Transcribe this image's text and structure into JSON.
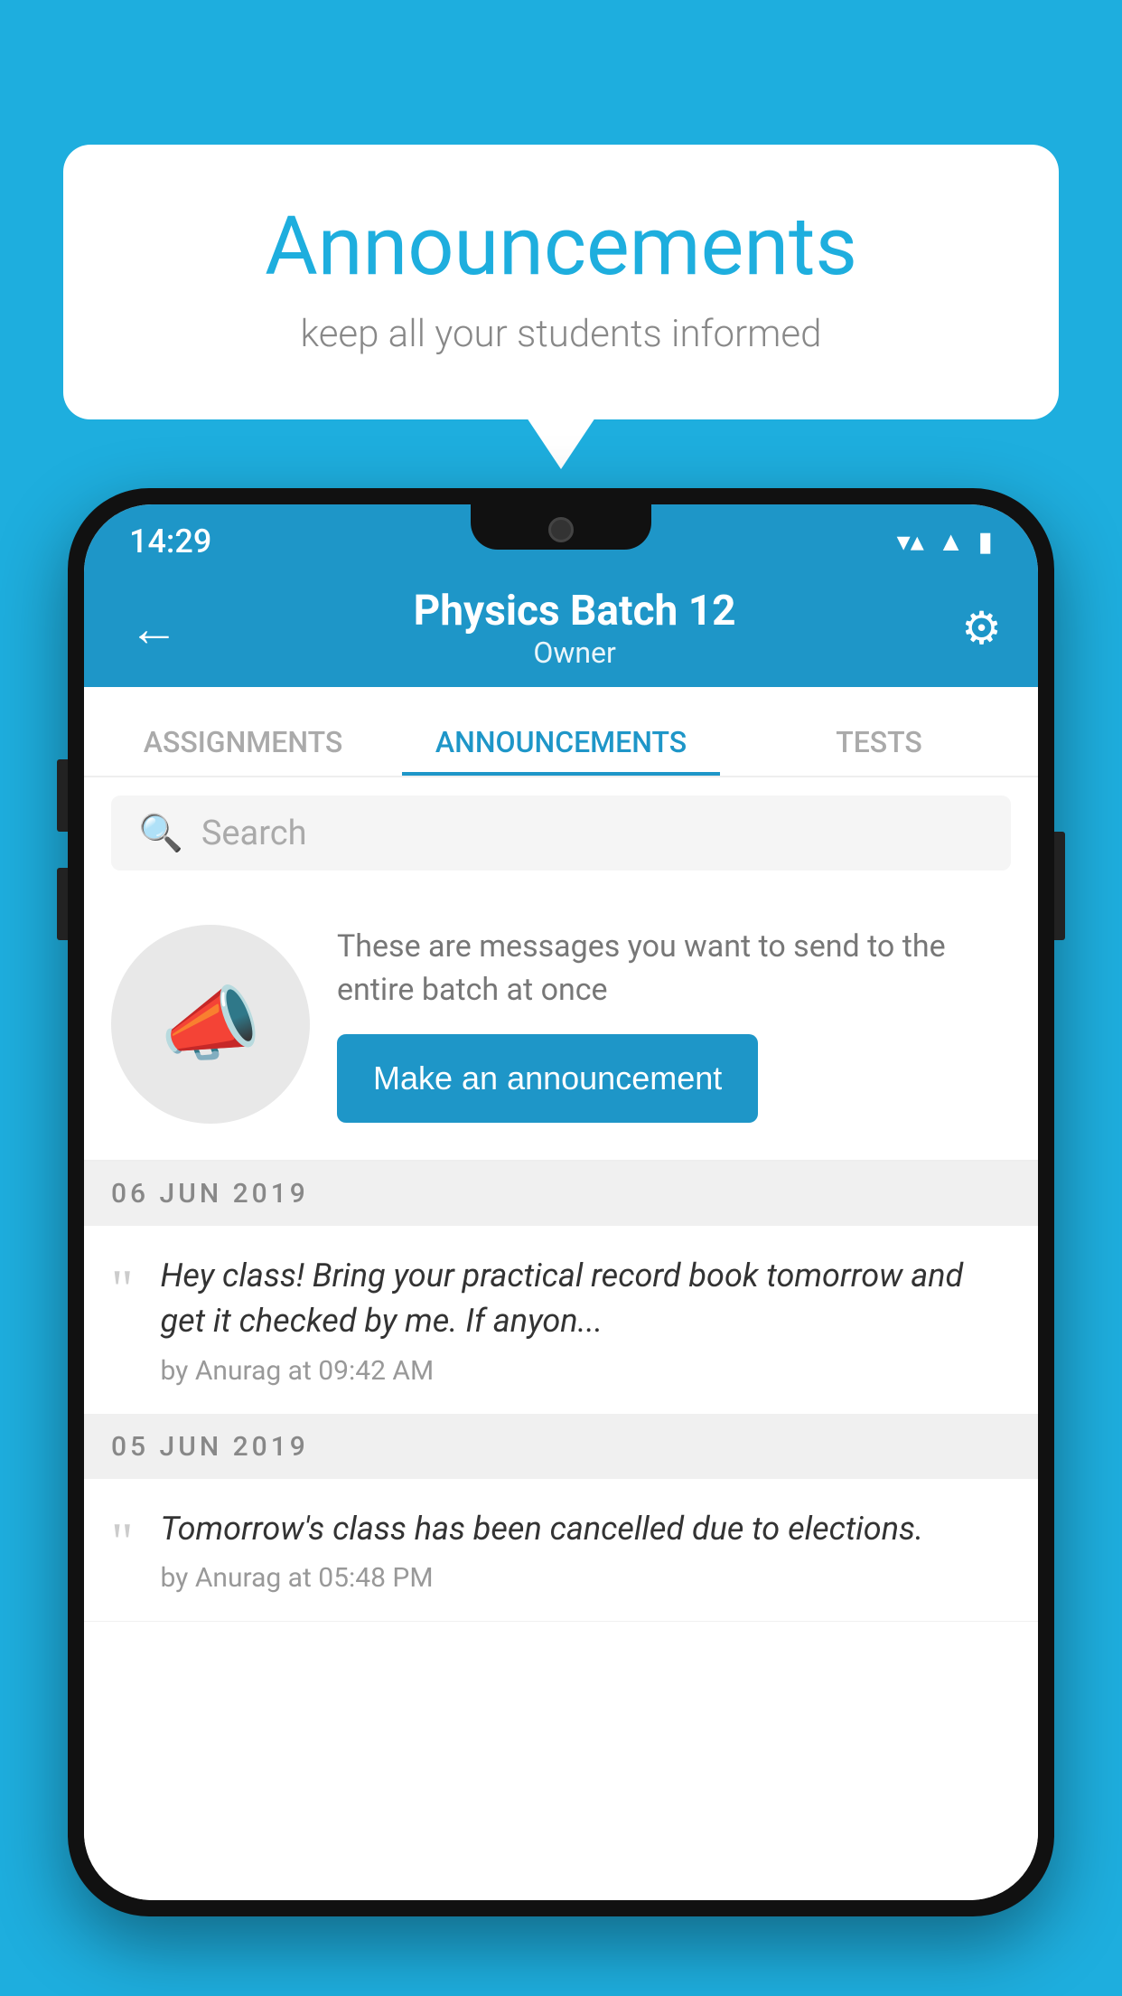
{
  "background_color": "#1EAEDE",
  "speech_bubble": {
    "title": "Announcements",
    "subtitle": "keep all your students informed"
  },
  "phone": {
    "status_bar": {
      "time": "14:29",
      "wifi": "▼",
      "signal": "▲",
      "battery": "▮"
    },
    "app_bar": {
      "back_label": "←",
      "title": "Physics Batch 12",
      "subtitle": "Owner",
      "settings_label": "⚙"
    },
    "tabs": [
      {
        "label": "ASSIGNMENTS",
        "active": false
      },
      {
        "label": "ANNOUNCEMENTS",
        "active": true
      },
      {
        "label": "TESTS",
        "active": false
      }
    ],
    "search": {
      "placeholder": "Search"
    },
    "promo": {
      "description": "These are messages you want to send to the entire batch at once",
      "button_label": "Make an announcement"
    },
    "announcements": [
      {
        "date": "06  JUN  2019",
        "text": "Hey class! Bring your practical record book tomorrow and get it checked by me. If anyon...",
        "author": "by Anurag at 09:42 AM"
      },
      {
        "date": "05  JUN  2019",
        "text": "Tomorrow's class has been cancelled due to elections.",
        "author": "by Anurag at 05:48 PM"
      }
    ]
  }
}
